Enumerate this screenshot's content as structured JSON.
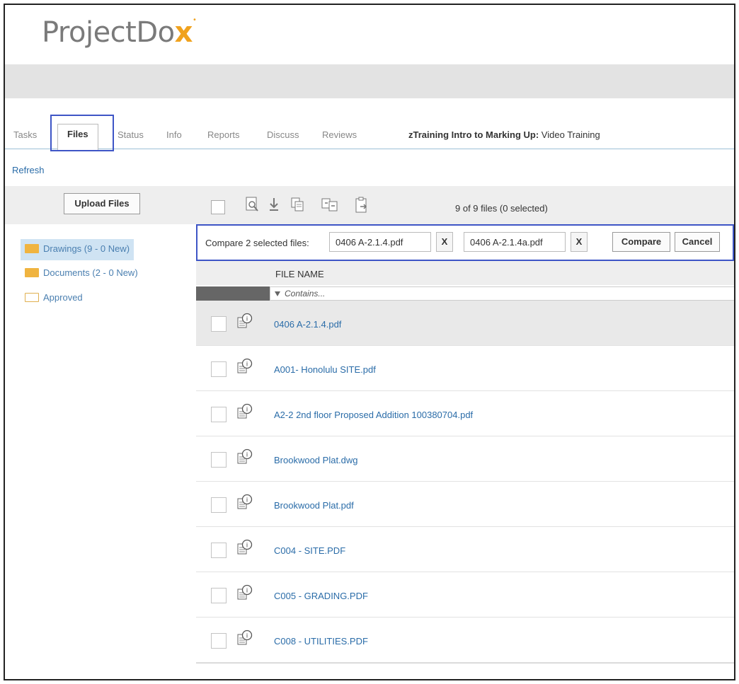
{
  "app": {
    "logo_prefix": "Project",
    "logo_suffix": "Do",
    "logo_x": "x",
    "accent_color": "#f0a21e",
    "highlight_color": "#3e55c6"
  },
  "tabs": [
    {
      "label": "Tasks"
    },
    {
      "label": "Files",
      "active": true
    },
    {
      "label": "Status"
    },
    {
      "label": "Info"
    },
    {
      "label": "Reports"
    },
    {
      "label": "Discuss"
    },
    {
      "label": "Reviews"
    }
  ],
  "project": {
    "name": "zTraining Intro to Marking Up:",
    "description": "Video Training"
  },
  "refresh_label": "Refresh",
  "left_panel": {
    "upload_label": "Upload Files",
    "folders": [
      {
        "label": "Drawings (9 - 0 New)",
        "selected": true
      },
      {
        "label": "Documents (2 - 0 New)"
      },
      {
        "label": "Approved"
      }
    ]
  },
  "toolbar": {
    "icons": [
      "view-icon",
      "download-icon",
      "copy-icon",
      "move-icon",
      "paste-icon"
    ],
    "file_count": "9 of 9 files (0 selected)"
  },
  "compare": {
    "label": "Compare 2 selected files:",
    "file1": "0406 A-2.1.4.pdf",
    "file2": "0406 A-2.1.4a.pdf",
    "remove_label": "X",
    "compare_label": "Compare",
    "cancel_label": "Cancel"
  },
  "table": {
    "column_header": "FILE NAME",
    "filter_placeholder": "Contains...",
    "rows": [
      {
        "name": "0406 A-2.1.4.pdf",
        "highlighted": true
      },
      {
        "name": "A001- Honolulu SITE.pdf"
      },
      {
        "name": "A2-2 2nd floor Proposed Addition 100380704.pdf"
      },
      {
        "name": "Brookwood Plat.dwg"
      },
      {
        "name": "Brookwood Plat.pdf"
      },
      {
        "name": "C004 - SITE.PDF"
      },
      {
        "name": "C005 - GRADING.PDF"
      },
      {
        "name": "C008 - UTILITIES.PDF"
      }
    ]
  }
}
